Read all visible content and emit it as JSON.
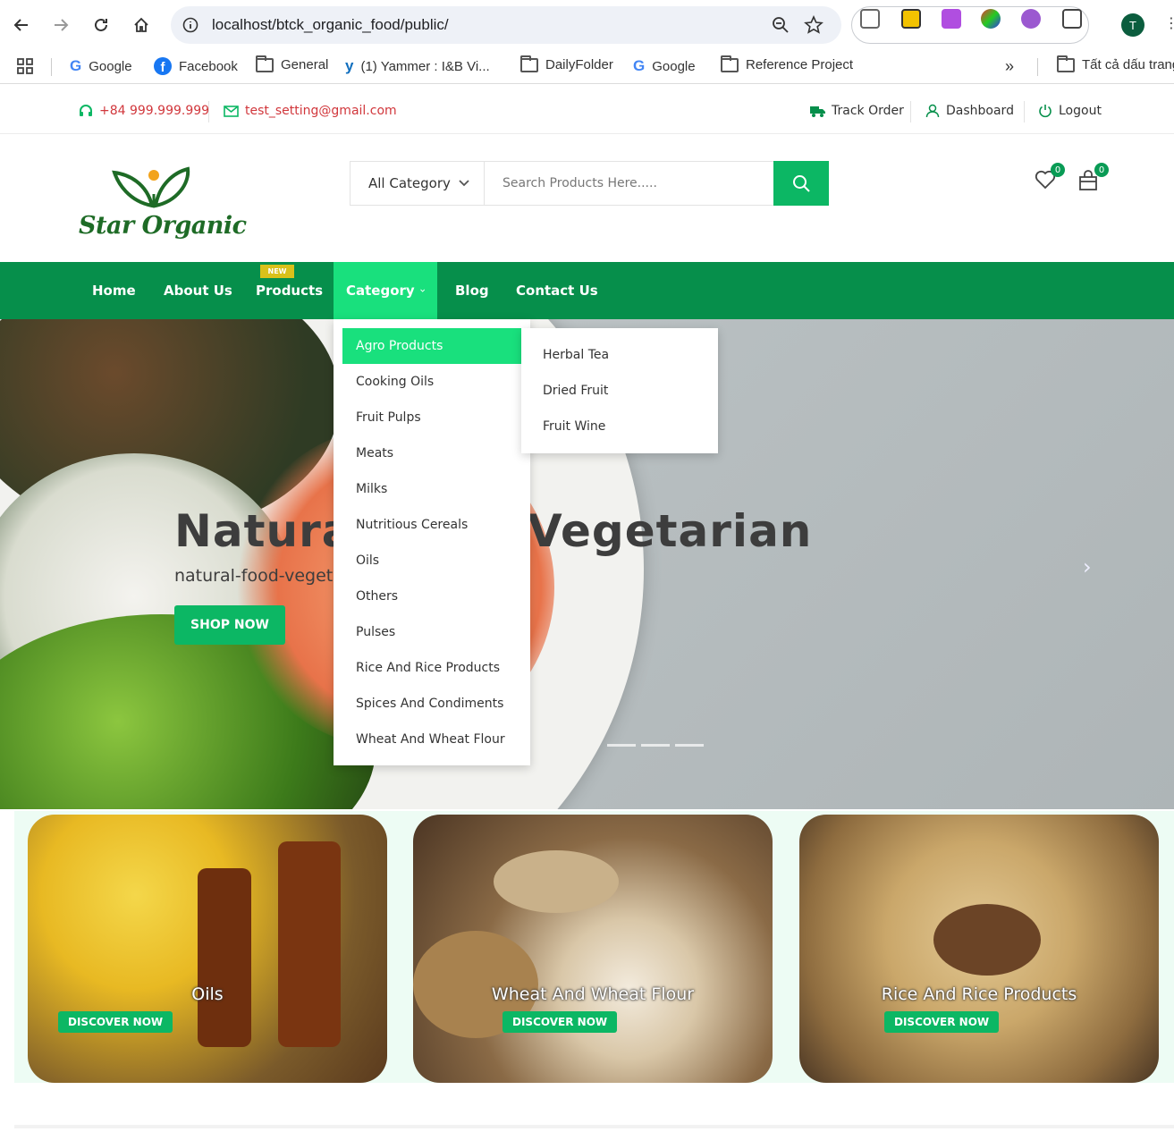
{
  "browser": {
    "url": "localhost/btck_organic_food/public/",
    "profile_initial": "T",
    "bookmarks": [
      {
        "label": "Google"
      },
      {
        "label": "Facebook"
      },
      {
        "label": "General"
      },
      {
        "label": "(1) Yammer : I&B Vi..."
      },
      {
        "label": "DailyFolder"
      },
      {
        "label": "Google"
      },
      {
        "label": "Reference Project"
      },
      {
        "label": "Tất cả dấu trang"
      }
    ]
  },
  "topbar": {
    "phone": "+84 999.999.999",
    "email": "test_setting@gmail.com",
    "track_order": "Track Order",
    "dashboard": "Dashboard",
    "logout": "Logout"
  },
  "header": {
    "logo_text": "Star Organic",
    "category_select": "All Category",
    "search_placeholder": "Search Products Here.....",
    "wishlist_count": "0",
    "cart_count": "0"
  },
  "nav": {
    "home": "Home",
    "about": "About Us",
    "products": "Products",
    "new_tag": "NEW",
    "category": "Category",
    "blog": "Blog",
    "contact": "Contact Us"
  },
  "category_menu": [
    "Agro Products",
    "Cooking Oils",
    "Fruit Pulps",
    "Meats",
    "Milks",
    "Nutritious Cereals",
    "Oils",
    "Others",
    "Pulses",
    "Rice And Rice Products",
    "Spices And Condiments",
    "Wheat And Wheat Flour"
  ],
  "category_submenu": [
    "Herbal Tea",
    "Dried Fruit",
    "Fruit Wine"
  ],
  "hero": {
    "title": "Natural Food Vegetarian",
    "subtitle": "natural-food-vegetarian",
    "button": "SHOP NOW"
  },
  "cards": [
    {
      "title": "Oils",
      "button": "DISCOVER NOW"
    },
    {
      "title": "Wheat And Wheat Flour",
      "button": "DISCOVER NOW"
    },
    {
      "title": "Rice And Rice Products",
      "button": "DISCOVER NOW"
    }
  ],
  "colors": {
    "brand_green": "#068f4b",
    "accent_green": "#0cb764",
    "active_green": "#19e07d",
    "contact_red": "#d1373c"
  }
}
